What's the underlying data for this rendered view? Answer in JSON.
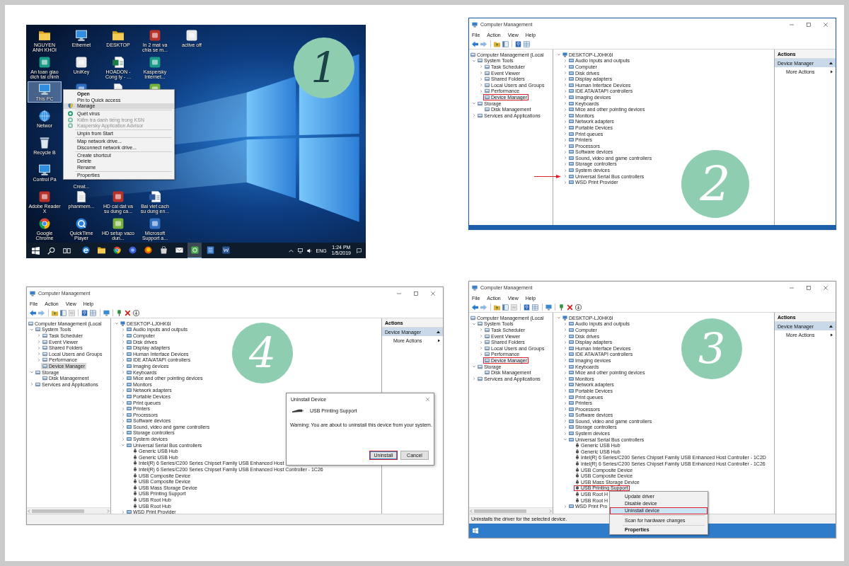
{
  "panels": [
    {
      "kind": "desktop",
      "badge": {
        "text": "1",
        "dark": true
      },
      "desktop": {
        "icons": [
          {
            "kind": "folder",
            "label": "NGUYEN ANH KHOI",
            "selected": false
          },
          {
            "kind": "computer",
            "label": "Ethernet",
            "selected": false
          },
          {
            "kind": "folder",
            "label": "DESKTOP",
            "selected": false
          },
          {
            "kind": "tile_red",
            "label": "In 2 mat va chia se m...",
            "selected": false
          },
          {
            "kind": "tile_white",
            "label": "active off",
            "selected": false
          },
          {
            "kind": "tile_teal",
            "label": "An toan giao dich tai chinh",
            "selected": false
          },
          {
            "kind": "tile_white",
            "label": "UniKey",
            "selected": false
          },
          {
            "kind": "sheet",
            "label": "HOADON - Cong ty - ...",
            "selected": false
          },
          {
            "kind": "tile_teal",
            "label": "Kaspersky Internet...",
            "selected": false
          },
          {
            "kind": "computer",
            "label": "This PC",
            "selected": true
          },
          {
            "kind": "tile_blue",
            "selected": false
          },
          {
            "kind": "doc",
            "selected": false
          },
          {
            "kind": "tile_green",
            "selected": false
          },
          {
            "kind": "globe",
            "label": "Networ",
            "selected": false
          },
          {
            "kind": "bin",
            "label": "Recycle B",
            "selected": false
          },
          {
            "kind": "computer",
            "label": "Control Pa",
            "selected": false
          },
          {
            "label": "Creat...",
            "selected": false
          },
          {
            "kind": "tile_red",
            "label": "Adobe Reader X",
            "selected": false
          },
          {
            "kind": "doc",
            "label": "phanmem...",
            "selected": false
          },
          {
            "kind": "tile_red",
            "label": "HD cai dat va su dung ca...",
            "selected": false
          },
          {
            "kind": "word",
            "label": "Bai viet cach su dung en...",
            "selected": false
          },
          {
            "kind": "browser",
            "label": "Google Chrome",
            "selected": false
          },
          {
            "kind": "player",
            "label": "QuickTime Player",
            "selected": false
          },
          {
            "kind": "tile_green",
            "label": "HD setup vaco dun...",
            "selected": false
          },
          {
            "kind": "tile_blue",
            "label": "Microsoft Support a...",
            "selected": false
          }
        ],
        "context_menu": [
          {
            "kind": "item",
            "label": "Open",
            "selected": false,
            "disabled": false,
            "default": true
          },
          {
            "kind": "item",
            "label": "Pin to Quick access",
            "selected": false,
            "disabled": false,
            "default": false
          },
          {
            "kind": "shield",
            "label": "Manage",
            "selected": true,
            "disabled": false,
            "default": false
          },
          {
            "kind": "separator"
          },
          {
            "kind": "antivirus",
            "label": "Quét virus",
            "selected": false,
            "disabled": false,
            "default": false
          },
          {
            "kind": "antivirus",
            "label": "Kiểm tra danh tiếng trong KSN",
            "selected": false,
            "disabled": true,
            "default": false
          },
          {
            "kind": "antivirus",
            "label": "Kaspersky Application Advisor",
            "selected": false,
            "disabled": true,
            "default": false
          },
          {
            "kind": "separator"
          },
          {
            "kind": "item",
            "label": "Unpin from Start",
            "selected": false,
            "disabled": false,
            "default": false
          },
          {
            "kind": "separator"
          },
          {
            "kind": "item",
            "label": "Map network drive...",
            "selected": false,
            "disabled": false,
            "default": false
          },
          {
            "kind": "item",
            "label": "Disconnect network drive...",
            "selected": false,
            "disabled": false,
            "default": false
          },
          {
            "kind": "separator"
          },
          {
            "kind": "item",
            "label": "Create shortcut",
            "selected": false,
            "disabled": false,
            "default": false
          },
          {
            "kind": "item",
            "label": "Delete",
            "selected": false,
            "disabled": false,
            "default": false
          },
          {
            "kind": "item",
            "label": "Rename",
            "selected": false,
            "disabled": false,
            "default": false
          },
          {
            "kind": "separator"
          },
          {
            "kind": "item",
            "label": "Properties",
            "selected": false,
            "disabled": false,
            "default": false
          }
        ],
        "taskbar": {
          "apps": [
            {
              "kind": "edge",
              "active": false
            },
            {
              "kind": "folder",
              "active": false
            },
            {
              "kind": "chrome",
              "active": false
            },
            {
              "kind": "globe",
              "active": false
            },
            {
              "kind": "fox",
              "active": false
            },
            {
              "kind": "bag",
              "active": false
            },
            {
              "kind": "mail",
              "active": false
            },
            {
              "kind": "green",
              "active": true
            },
            {
              "kind": "doc",
              "active": false
            },
            {
              "kind": "word",
              "active": false
            }
          ],
          "language": "ENG",
          "time": "1:24 PM",
          "date": "1/5/2019"
        }
      }
    },
    {
      "kind": "computer_management",
      "badge": {
        "text": "2",
        "dark": false
      },
      "focused": true,
      "device_toolbar": false,
      "title": "Computer Management",
      "menu": [
        "File",
        "Action",
        "View",
        "Help"
      ],
      "console_tree": [
        {
          "label": "Computer Management (Local",
          "selected": false,
          "children": [
            {
              "label": "System Tools",
              "expanded": true,
              "selected": false,
              "children": [
                {
                  "label": "Task Scheduler",
                  "expanded": false,
                  "selected": false
                },
                {
                  "label": "Event Viewer",
                  "expanded": false,
                  "selected": false
                },
                {
                  "label": "Shared Folders",
                  "expanded": false,
                  "selected": false
                },
                {
                  "label": "Local Users and Groups",
                  "expanded": false,
                  "selected": false
                },
                {
                  "label": "Performance",
                  "expanded": false,
                  "selected": false
                },
                {
                  "label": "Device Manager",
                  "selected": true,
                  "boxed": true
                }
              ]
            },
            {
              "label": "Storage",
              "expanded": true,
              "selected": false,
              "children": [
                {
                  "label": "Disk Management",
                  "selected": false
                }
              ]
            },
            {
              "label": "Services and Applications",
              "expanded": false,
              "selected": false
            }
          ]
        }
      ],
      "device_tree": [
        {
          "label": "DESKTOP-LJ0HK6I",
          "expanded": true,
          "selected": false,
          "children": [
            {
              "label": "Audio inputs and outputs",
              "expanded": false,
              "selected": false
            },
            {
              "label": "Computer",
              "expanded": false,
              "selected": false
            },
            {
              "label": "Disk drives",
              "expanded": false,
              "selected": false
            },
            {
              "label": "Display adapters",
              "expanded": false,
              "selected": false
            },
            {
              "label": "Human Interface Devices",
              "expanded": false,
              "selected": false
            },
            {
              "label": "IDE ATA/ATAPI controllers",
              "expanded": false,
              "selected": false
            },
            {
              "label": "Imaging devices",
              "expanded": false,
              "selected": false
            },
            {
              "label": "Keyboards",
              "expanded": false,
              "selected": false
            },
            {
              "label": "Mice and other pointing devices",
              "expanded": false,
              "selected": false
            },
            {
              "label": "Monitors",
              "expanded": false,
              "selected": false
            },
            {
              "label": "Network adapters",
              "expanded": false,
              "selected": false
            },
            {
              "label": "Portable Devices",
              "expanded": false,
              "selected": false
            },
            {
              "label": "Print queues",
              "expanded": false,
              "selected": false
            },
            {
              "label": "Printers",
              "expanded": false,
              "selected": false
            },
            {
              "label": "Processors",
              "expanded": false,
              "selected": false
            },
            {
              "label": "Software devices",
              "expanded": false,
              "selected": false
            },
            {
              "label": "Sound, video and game controllers",
              "expanded": false,
              "selected": false
            },
            {
              "label": "Storage controllers",
              "expanded": false,
              "selected": false
            },
            {
              "label": "System devices",
              "expanded": false,
              "selected": false
            },
            {
              "label": "Universal Serial Bus controllers",
              "expanded": false,
              "selected": false,
              "pointed": true
            },
            {
              "label": "WSD Print Provider",
              "expanded": false,
              "selected": false
            }
          ]
        }
      ],
      "actions": {
        "header": "Actions",
        "section": {
          "label": "Device Manager",
          "expanded": true
        },
        "items": [
          {
            "label": "More Actions",
            "submenu": true
          }
        ]
      }
    },
    {
      "kind": "computer_management",
      "badge": {
        "text": "4",
        "dark": false
      },
      "focused": false,
      "device_toolbar": true,
      "console_tree_scrollbar": true,
      "title": "Computer Management",
      "menu": [
        "File",
        "Action",
        "View",
        "Help"
      ],
      "console_tree": [
        {
          "label": "Computer Management (Local",
          "selected": false,
          "children": [
            {
              "label": "System Tools",
              "expanded": true,
              "selected": false,
              "children": [
                {
                  "label": "Task Scheduler",
                  "expanded": false,
                  "selected": false
                },
                {
                  "label": "Event Viewer",
                  "expanded": false,
                  "selected": false
                },
                {
                  "label": "Shared Folders",
                  "expanded": false,
                  "selected": false
                },
                {
                  "label": "Local Users and Groups",
                  "expanded": false,
                  "selected": false
                },
                {
                  "label": "Performance",
                  "expanded": false,
                  "selected": false
                },
                {
                  "label": "Device Manager",
                  "selected": true
                }
              ]
            },
            {
              "label": "Storage",
              "expanded": true,
              "selected": false,
              "children": [
                {
                  "label": "Disk Management",
                  "selected": false
                }
              ]
            },
            {
              "label": "Services and Applications",
              "expanded": false,
              "selected": false
            }
          ]
        }
      ],
      "device_tree": [
        {
          "label": "DESKTOP-LJ0HK6I",
          "expanded": true,
          "selected": false,
          "children": [
            {
              "label": "Audio inputs and outputs",
              "expanded": false,
              "selected": false
            },
            {
              "label": "Computer",
              "expanded": false,
              "selected": false
            },
            {
              "label": "Disk drives",
              "expanded": false,
              "selected": false
            },
            {
              "label": "Display adapters",
              "expanded": false,
              "selected": false
            },
            {
              "label": "Human Interface Devices",
              "expanded": false,
              "selected": false
            },
            {
              "label": "IDE ATA/ATAPI controllers",
              "expanded": false,
              "selected": false
            },
            {
              "label": "Imaging devices",
              "expanded": false,
              "selected": false
            },
            {
              "label": "Keyboards",
              "expanded": false,
              "selected": false
            },
            {
              "label": "Mice and other pointing devices",
              "expanded": false,
              "selected": false
            },
            {
              "label": "Monitors",
              "expanded": false,
              "selected": false
            },
            {
              "label": "Network adapters",
              "expanded": false,
              "selected": false
            },
            {
              "label": "Portable Devices",
              "expanded": false,
              "selected": false
            },
            {
              "label": "Print queues",
              "expanded": false,
              "selected": false
            },
            {
              "label": "Printers",
              "expanded": false,
              "selected": false
            },
            {
              "label": "Processors",
              "expanded": false,
              "selected": false
            },
            {
              "label": "Software devices",
              "expanded": false,
              "selected": false
            },
            {
              "label": "Sound, video and game controllers",
              "expanded": false,
              "selected": false
            },
            {
              "label": "Storage controllers",
              "expanded": false,
              "selected": false
            },
            {
              "label": "System devices",
              "expanded": false,
              "selected": false
            },
            {
              "label": "Universal Serial Bus controllers",
              "expanded": true,
              "selected": false,
              "children": [
                {
                  "label": "Generic USB Hub",
                  "selected": false
                },
                {
                  "label": "Generic USB Hub",
                  "selected": false
                },
                {
                  "label": "Intel(R) 6 Series/C200 Series Chipset Family USB Enhanced Host",
                  "selected": false
                },
                {
                  "label": "Intel(R) 6 Series/C200 Series Chipset Family USB Enhanced Host Controller - 1C26",
                  "selected": false
                },
                {
                  "label": "USB Composite Device",
                  "selected": false
                },
                {
                  "label": "USB Composite Device",
                  "selected": false
                },
                {
                  "label": "USB Mass Storage Device",
                  "selected": false
                },
                {
                  "label": "USB Printing Support",
                  "selected": false
                },
                {
                  "label": "USB Root Hub",
                  "selected": false
                },
                {
                  "label": "USB Root Hub",
                  "selected": false
                }
              ]
            },
            {
              "label": "WSD Print Provider",
              "expanded": false,
              "selected": false
            }
          ]
        }
      ],
      "actions": {
        "header": "Actions",
        "section": {
          "label": "Device Manager",
          "expanded": true
        },
        "items": [
          {
            "label": "More Actions",
            "submenu": true
          }
        ]
      },
      "status_bar": {
        "visible": true
      },
      "dialog": {
        "title": "Uninstall Device",
        "device": "USB Printing Support",
        "message": "Warning: You are about to uninstall this device from your system.",
        "buttons": [
          {
            "label": "Uninstall",
            "focused": true,
            "boxed": true
          },
          {
            "label": "Cancel",
            "focused": false
          }
        ]
      }
    },
    {
      "kind": "computer_management",
      "badge": {
        "text": "3",
        "dark": false
      },
      "focused": false,
      "device_toolbar": true,
      "console_tree_scrollbar": true,
      "title": "Computer Management",
      "menu": [
        "File",
        "Action",
        "View",
        "Help"
      ],
      "console_tree": [
        {
          "label": "Computer Management (Local",
          "selected": false,
          "children": [
            {
              "label": "System Tools",
              "expanded": true,
              "selected": false,
              "children": [
                {
                  "label": "Task Scheduler",
                  "expanded": false,
                  "selected": false
                },
                {
                  "label": "Event Viewer",
                  "expanded": false,
                  "selected": false
                },
                {
                  "label": "Shared Folders",
                  "expanded": false,
                  "selected": false
                },
                {
                  "label": "Local Users and Groups",
                  "expanded": false,
                  "selected": false
                },
                {
                  "label": "Performance",
                  "expanded": false,
                  "selected": false
                },
                {
                  "label": "Device Manager",
                  "selected": true,
                  "boxed": true
                }
              ]
            },
            {
              "label": "Storage",
              "expanded": true,
              "selected": false,
              "children": [
                {
                  "label": "Disk Management",
                  "selected": false
                }
              ]
            },
            {
              "label": "Services and Applications",
              "expanded": false,
              "selected": false
            }
          ]
        }
      ],
      "device_tree": [
        {
          "label": "DESKTOP-LJ0HK6I",
          "expanded": true,
          "selected": false,
          "children": [
            {
              "label": "Audio inputs and outputs",
              "expanded": false,
              "selected": false
            },
            {
              "label": "Computer",
              "expanded": false,
              "selected": false
            },
            {
              "label": "Disk drives",
              "expanded": false,
              "selected": false
            },
            {
              "label": "Display adapters",
              "expanded": false,
              "selected": false
            },
            {
              "label": "Human Interface Devices",
              "expanded": false,
              "selected": false
            },
            {
              "label": "IDE ATA/ATAPI controllers",
              "expanded": false,
              "selected": false
            },
            {
              "label": "Imaging devices",
              "expanded": false,
              "selected": false
            },
            {
              "label": "Keyboards",
              "expanded": false,
              "selected": false
            },
            {
              "label": "Mice and other pointing devices",
              "expanded": false,
              "selected": false
            },
            {
              "label": "Monitors",
              "expanded": false,
              "selected": false
            },
            {
              "label": "Network adapters",
              "expanded": false,
              "selected": false
            },
            {
              "label": "Portable Devices",
              "expanded": false,
              "selected": false
            },
            {
              "label": "Print queues",
              "expanded": false,
              "selected": false
            },
            {
              "label": "Printers",
              "expanded": false,
              "selected": false
            },
            {
              "label": "Processors",
              "expanded": false,
              "selected": false
            },
            {
              "label": "Software devices",
              "expanded": false,
              "selected": false
            },
            {
              "label": "Sound, video and game controllers",
              "expanded": false,
              "selected": false
            },
            {
              "label": "Storage controllers",
              "expanded": false,
              "selected": false
            },
            {
              "label": "System devices",
              "expanded": false,
              "selected": false
            },
            {
              "label": "Universal Serial Bus controllers",
              "expanded": true,
              "selected": false,
              "children": [
                {
                  "label": "Generic USB Hub",
                  "selected": false
                },
                {
                  "label": "Generic USB Hub",
                  "selected": false
                },
                {
                  "label": "Intel(R) 6 Series/C200 Series Chipset Family USB Enhanced Host Controller - 1C2D",
                  "selected": false
                },
                {
                  "label": "Intel(R) 6 Series/C200 Series Chipset Family USB Enhanced Host Controller - 1C26",
                  "selected": false
                },
                {
                  "label": "USB Composite Device",
                  "selected": false
                },
                {
                  "label": "USB Composite Device",
                  "selected": false
                },
                {
                  "label": "USB Mass Storage Device",
                  "selected": false
                },
                {
                  "label": "USB Printing Support",
                  "selected": true,
                  "boxed": true,
                  "context_menu": [
                    {
                      "kind": "item",
                      "label": "Update driver",
                      "selected": false,
                      "default": false
                    },
                    {
                      "kind": "item",
                      "label": "Disable device",
                      "selected": false,
                      "default": false
                    },
                    {
                      "kind": "item",
                      "label": "Uninstall device",
                      "selected": true,
                      "default": false,
                      "boxed": true
                    },
                    {
                      "kind": "separator"
                    },
                    {
                      "kind": "item",
                      "label": "Scan for hardware changes",
                      "selected": false,
                      "default": false
                    },
                    {
                      "kind": "separator"
                    },
                    {
                      "kind": "item",
                      "label": "Properties",
                      "selected": false,
                      "default": true
                    }
                  ]
                },
                {
                  "label": "USB Root H",
                  "selected": false
                },
                {
                  "label": "USB Root H",
                  "selected": false
                }
              ]
            },
            {
              "label": "WSD Print Pro",
              "expanded": false,
              "selected": false
            }
          ]
        }
      ],
      "actions": {
        "header": "Actions",
        "section": {
          "label": "Device Manager",
          "expanded": true
        },
        "items": [
          {
            "label": "More Actions",
            "submenu": true
          }
        ]
      },
      "status_bar": {
        "visible": true,
        "text": "Uninstalls the driver for the selected device."
      },
      "taskbar": {
        "visible": true
      }
    }
  ]
}
